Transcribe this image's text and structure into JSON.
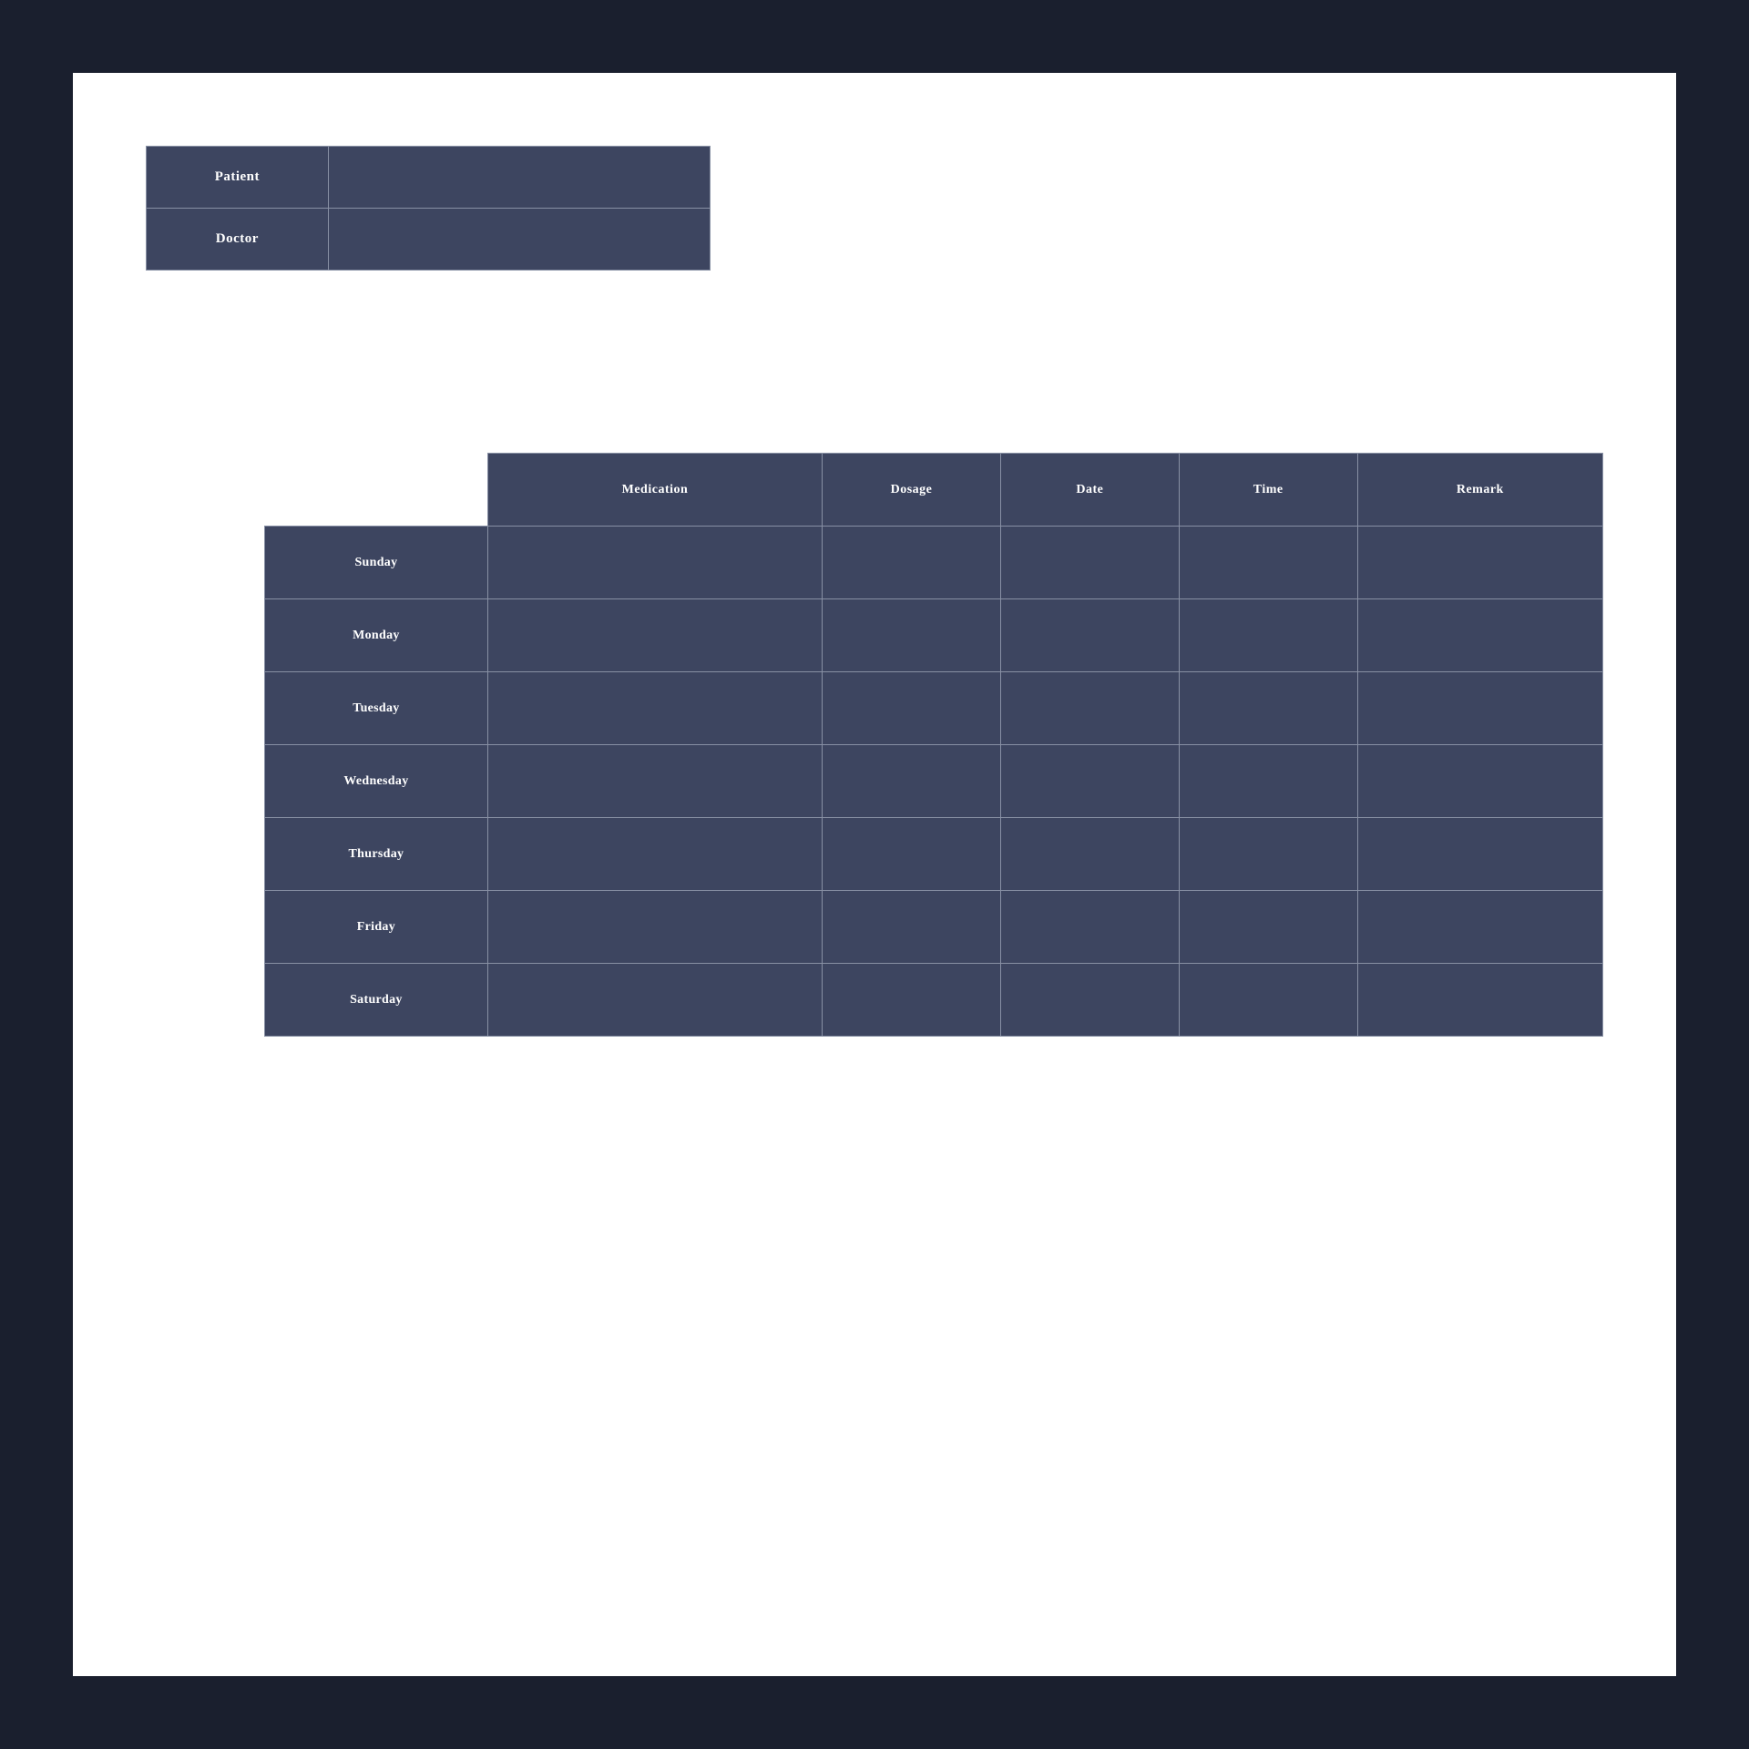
{
  "info": {
    "patient_label": "Patient",
    "doctor_label": "Doctor",
    "patient_value": "",
    "doctor_value": ""
  },
  "schedule": {
    "columns": [
      "Medication",
      "Dosage",
      "Date",
      "Time",
      "Remark"
    ],
    "days": [
      "Sunday",
      "Monday",
      "Tuesday",
      "Wednesday",
      "Thursday",
      "Friday",
      "Saturday"
    ]
  }
}
